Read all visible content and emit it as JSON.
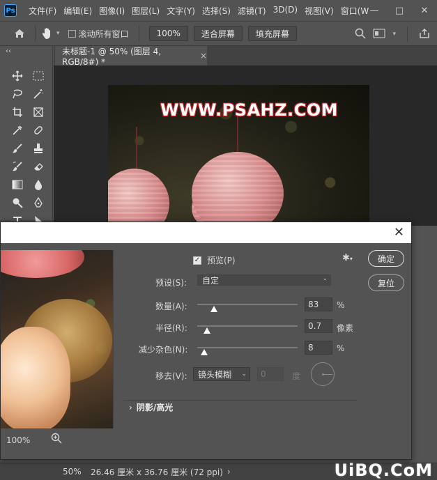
{
  "app": {
    "logo": "Ps"
  },
  "menu": [
    "文件(F)",
    "编辑(E)",
    "图像(I)",
    "图层(L)",
    "文字(Y)",
    "选择(S)",
    "滤镜(T)",
    "3D(D)",
    "视图(V)",
    "窗口(W"
  ],
  "window_controls": {
    "minimize": "—",
    "maximize": "□",
    "close": "✕"
  },
  "options_bar": {
    "scroll_all_windows": "滚动所有窗口",
    "zoom_value": "100%",
    "fit_screen": "适合屏幕",
    "fill_screen": "填充屏幕"
  },
  "toolbar": {
    "collapse": "‹‹"
  },
  "document": {
    "tab_title": "未标题-1 @ 50% (图层 4, RGB/8#) *",
    "tab_close": "×",
    "watermark_text": "WWW.PSAHZ.COM"
  },
  "status_bar": {
    "zoom": "50%",
    "doc_info": "26.46 厘米 x 36.76 厘米 (72 ppi)",
    "arrow": "›"
  },
  "site_watermark": "UiBQ.CoM",
  "dialog": {
    "close": "✕",
    "preview_label": "预览(P)",
    "preview_checked": true,
    "preset_label": "预设(S):",
    "preset_value": "自定",
    "amount_label": "数量(A):",
    "amount_value": "83",
    "amount_unit": "%",
    "amount_fraction": 0.17,
    "radius_label": "半径(R):",
    "radius_value": "0.7",
    "radius_unit": "像素",
    "radius_fraction": 0.1,
    "noise_label": "减少杂色(N):",
    "noise_value": "8",
    "noise_unit": "%",
    "noise_fraction": 0.07,
    "remove_label": "移去(V):",
    "remove_value": "镜头模糊",
    "angle_value": "0",
    "angle_unit": "度",
    "ok_button": "确定",
    "reset_button": "复位",
    "section_label": "阴影/高光",
    "preview_zoom": "100%"
  }
}
